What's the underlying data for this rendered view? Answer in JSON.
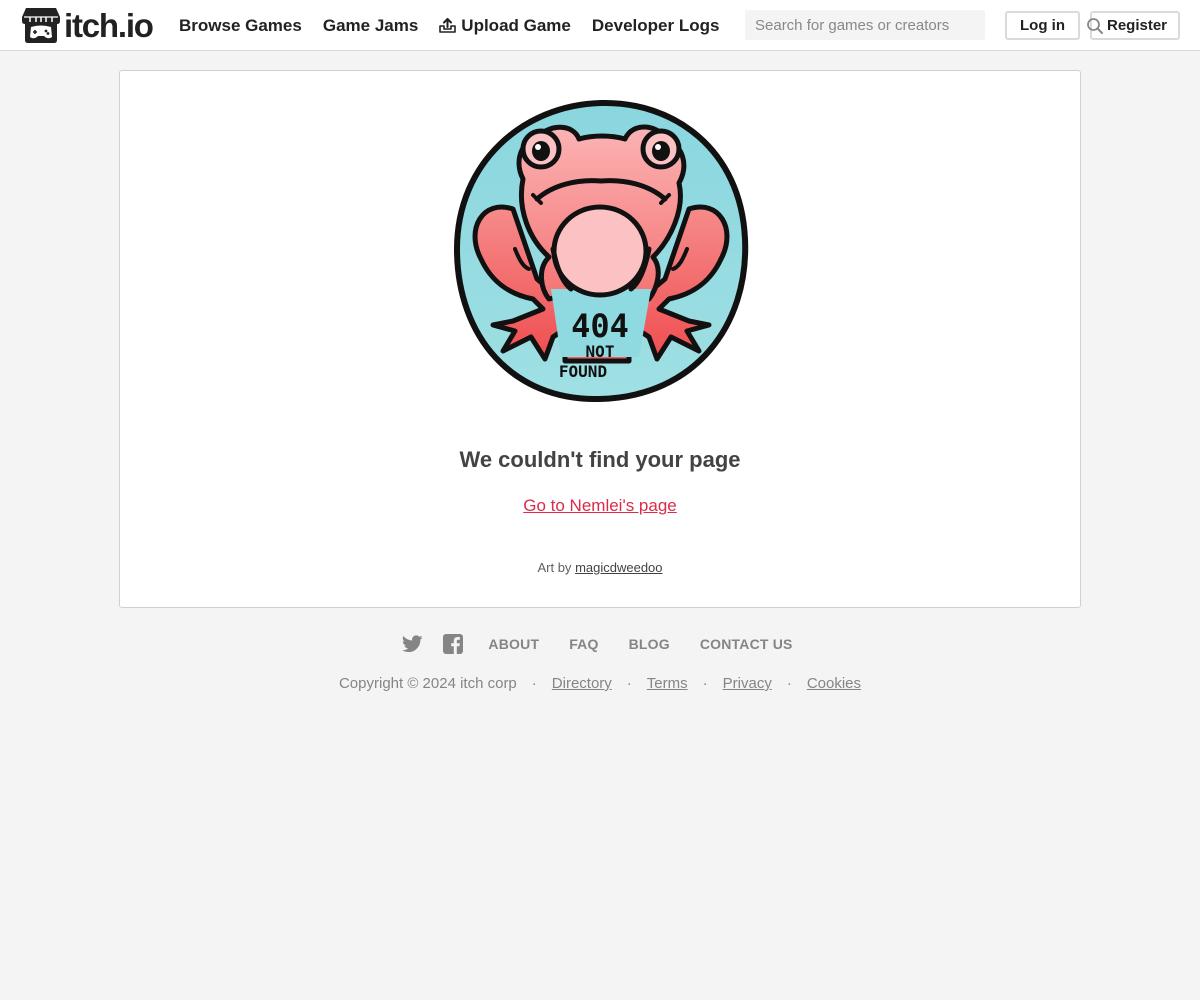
{
  "header": {
    "logo_text": "itch.io",
    "nav": [
      {
        "label": "Browse Games"
      },
      {
        "label": "Game Jams"
      },
      {
        "label": "Upload Game",
        "icon": "upload-icon"
      },
      {
        "label": "Developer Logs"
      }
    ],
    "search": {
      "placeholder": "Search for games or creators",
      "value": ""
    },
    "login_label": "Log in",
    "register_label": "Register"
  },
  "main": {
    "art_text_line1": "404",
    "art_text_line2": "NOT",
    "art_text_line3": "FOUND",
    "title": "We couldn't find your page",
    "user_link": "Go to Nemlei's page",
    "credit_prefix": "Art by",
    "credit_name": "magicdweedoo"
  },
  "footer": {
    "social": [
      "twitter-icon",
      "facebook-icon"
    ],
    "links": [
      "ABOUT",
      "FAQ",
      "BLOG",
      "CONTACT US"
    ],
    "copyright": "Copyright © 2024 itch corp",
    "separator": "·",
    "bottom_links": [
      "Directory",
      "Terms",
      "Privacy",
      "Cookies"
    ]
  },
  "colors": {
    "accent": "#da2c49",
    "frog_bg": "#8fd9e0",
    "frog_body": "#f7837f"
  }
}
